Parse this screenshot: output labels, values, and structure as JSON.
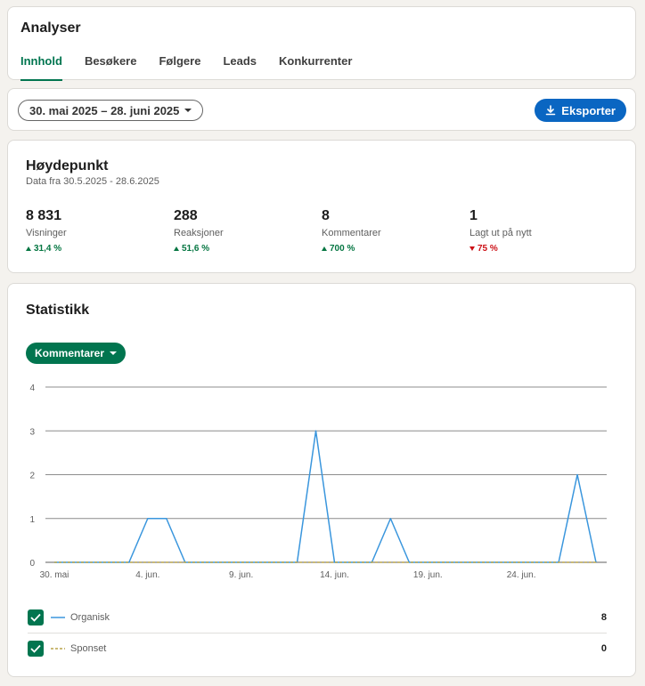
{
  "header": {
    "title": "Analyser",
    "tabs": [
      {
        "label": "Innhold",
        "active": true
      },
      {
        "label": "Besøkere",
        "active": false
      },
      {
        "label": "Følgere",
        "active": false
      },
      {
        "label": "Leads",
        "active": false
      },
      {
        "label": "Konkurrenter",
        "active": false
      }
    ]
  },
  "filters": {
    "date_range": "30. mai 2025 – 28. juni 2025",
    "export_label": "Eksporter"
  },
  "highlights": {
    "title": "Høydepunkt",
    "subtitle": "Data fra 30.5.2025 - 28.6.2025",
    "metrics": [
      {
        "value": "8 831",
        "label": "Visninger",
        "change": "31,4 %",
        "direction": "up"
      },
      {
        "value": "288",
        "label": "Reaksjoner",
        "change": "51,6 %",
        "direction": "up"
      },
      {
        "value": "8",
        "label": "Kommentarer",
        "change": "700 %",
        "direction": "up"
      },
      {
        "value": "1",
        "label": "Lagt ut på nytt",
        "change": "75 %",
        "direction": "down"
      }
    ]
  },
  "stats": {
    "title": "Statistikk",
    "metric_select": "Kommentarer",
    "legend": [
      {
        "label": "Organisk",
        "count": "8",
        "color": "#3a96dd",
        "style": "solid"
      },
      {
        "label": "Sponset",
        "count": "0",
        "color": "#b8a44a",
        "style": "dashed"
      }
    ]
  },
  "chart_data": {
    "type": "line",
    "x": [
      "30. mai",
      "31. mai",
      "1. jun.",
      "2. jun.",
      "3. jun.",
      "4. jun.",
      "5. jun.",
      "6. jun.",
      "7. jun.",
      "8. jun.",
      "9. jun.",
      "10. jun.",
      "11. jun.",
      "12. jun.",
      "13. jun.",
      "14. jun.",
      "15. jun.",
      "16. jun.",
      "17. jun.",
      "18. jun.",
      "19. jun.",
      "20. jun.",
      "21. jun.",
      "22. jun.",
      "23. jun.",
      "24. jun.",
      "25. jun.",
      "26. jun.",
      "27. jun.",
      "28. jun."
    ],
    "tick_labels": [
      "30. mai",
      "4. jun.",
      "9. jun.",
      "14. jun.",
      "19. jun.",
      "24. jun."
    ],
    "tick_indices": [
      0,
      5,
      10,
      15,
      20,
      25
    ],
    "yticks": [
      0,
      1,
      2,
      3,
      4
    ],
    "ylim": [
      0,
      4
    ],
    "grid": true,
    "series": [
      {
        "name": "Organisk",
        "color": "#3a96dd",
        "values": [
          0,
          0,
          0,
          0,
          0,
          1,
          1,
          0,
          0,
          0,
          0,
          0,
          0,
          0,
          3,
          0,
          0,
          0,
          1,
          0,
          0,
          0,
          0,
          0,
          0,
          0,
          0,
          0,
          2,
          0
        ]
      },
      {
        "name": "Sponset",
        "color": "#b8a44a",
        "dashed": true,
        "values": [
          0,
          0,
          0,
          0,
          0,
          0,
          0,
          0,
          0,
          0,
          0,
          0,
          0,
          0,
          0,
          0,
          0,
          0,
          0,
          0,
          0,
          0,
          0,
          0,
          0,
          0,
          0,
          0,
          0,
          0
        ]
      }
    ]
  }
}
